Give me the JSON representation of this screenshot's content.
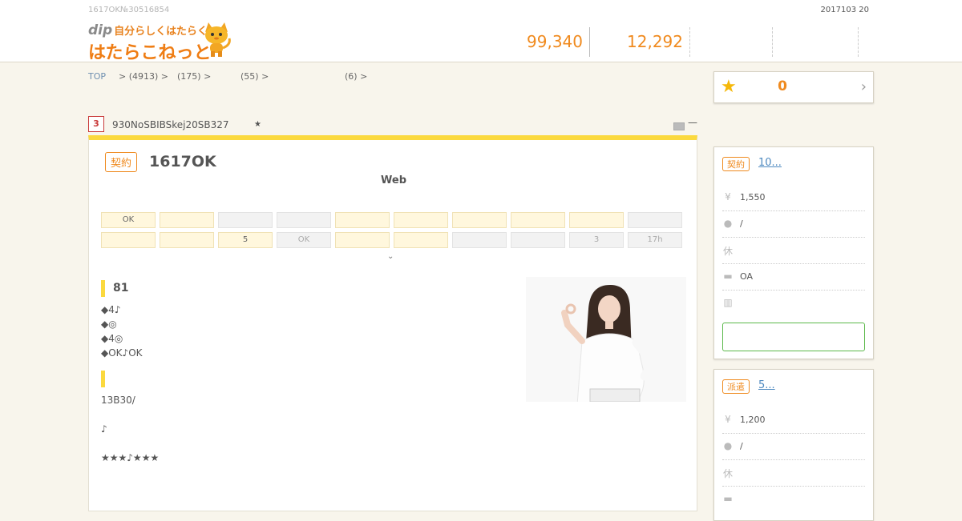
{
  "header": {
    "small_text": "1617OK№30516854",
    "date": "2017103 20",
    "logo": {
      "brand": "dip",
      "tagline": "自分らしくはたらく",
      "name": "はたらこねっと"
    },
    "counters": [
      "99,340",
      "12,292"
    ]
  },
  "breadcrumb": [
    "TOP",
    "> (4913) >",
    "(175) >",
    "(55) >",
    "(6) >"
  ],
  "favorites": {
    "count": "0",
    "icon": "star-icon",
    "arrow": "›"
  },
  "job": {
    "rank": "3",
    "id": "930NoSBIBSkej20SB327",
    "star": "★",
    "badge": "契約",
    "title": "1617OK",
    "subtitle": "Web",
    "grid_row1": [
      "OK",
      "",
      "",
      "",
      "",
      "",
      "",
      "",
      "",
      ""
    ],
    "grid_row2": [
      "",
      "",
      "5",
      "OK",
      "",
      "",
      "",
      "",
      "3",
      "17h"
    ],
    "more": "⌄",
    "section1_title": "81",
    "section1_lines": [
      "◆4♪",
      "◆◎",
      "◆4◎",
      "◆OK♪OK"
    ],
    "section2_lines": [
      "13B30/",
      "♪",
      "★★★♪★★★"
    ]
  },
  "side_cards": [
    {
      "badge": "契約",
      "title": "10...",
      "rows": [
        {
          "icon": "yen-icon",
          "text": "1,550"
        },
        {
          "icon": "location-icon",
          "text": "/"
        },
        {
          "icon": "holiday-icon",
          "text": ""
        },
        {
          "icon": "briefcase-icon",
          "text": "OA"
        },
        {
          "icon": "building-icon",
          "text": ""
        }
      ]
    },
    {
      "badge": "派遣",
      "title": "5...",
      "rows": [
        {
          "icon": "yen-icon",
          "text": "1,200"
        },
        {
          "icon": "location-icon",
          "text": "/"
        },
        {
          "icon": "holiday-icon",
          "text": ""
        },
        {
          "icon": "briefcase-icon",
          "text": ""
        }
      ]
    }
  ],
  "colors": {
    "accent": "#ef8a1e",
    "highlight": "#fbd93e",
    "link": "#4f8ac0",
    "button_border": "#5bb84a"
  }
}
